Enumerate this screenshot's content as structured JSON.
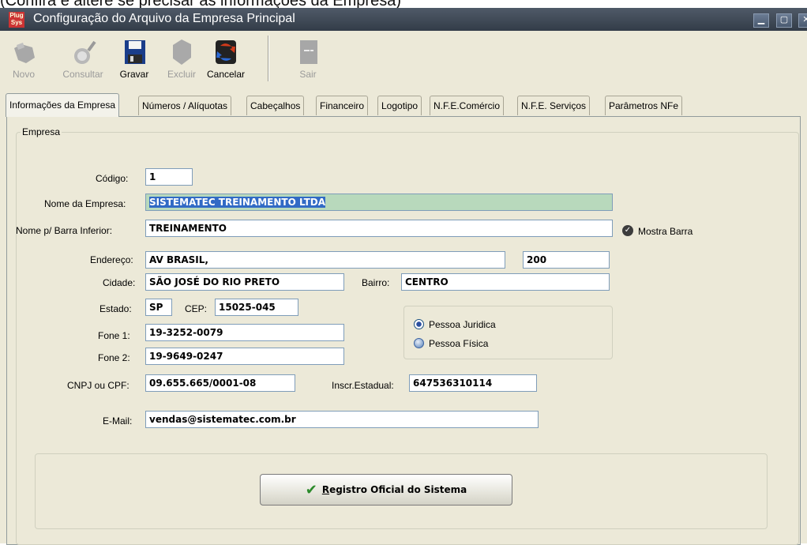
{
  "caption": "(Confira e altere se precisar as informações da Empresa)",
  "window": {
    "title": "Configuração do Arquivo da Empresa Principal",
    "app_icon_text": "Plug Sys"
  },
  "toolbar": {
    "novo": "Novo",
    "consultar": "Consultar",
    "gravar": "Gravar",
    "excluir": "Excluir",
    "cancelar": "Cancelar",
    "sair": "Sair"
  },
  "tabs": [
    "Informações da Empresa",
    "Números / Alíquotas",
    "Cabeçalhos",
    "Financeiro",
    "Logotipo",
    "N.F.E.Comércio",
    "N.F.E. Serviços",
    "Parâmetros NFe"
  ],
  "group_label": "Empresa",
  "labels": {
    "codigo": "Código:",
    "nome": "Nome da Empresa:",
    "barra": "Nome p/ Barra Inferior:",
    "mostra_barra": "Mostra Barra",
    "endereco": "Endereço:",
    "cidade": "Cidade:",
    "bairro": "Bairro:",
    "estado": "Estado:",
    "cep": "CEP:",
    "fone1": "Fone 1:",
    "fone2": "Fone 2:",
    "cnpj": "CNPJ ou CPF:",
    "inscr": "Inscr.Estadual:",
    "email": "E-Mail:"
  },
  "values": {
    "codigo": "1",
    "nome": "SISTEMATEC TREINAMENTO LTDA",
    "barra": "TREINAMENTO",
    "endereco": "AV BRASIL,",
    "numero": "200",
    "cidade": "SÃO JOSÉ DO RIO PRETO",
    "bairro": "CENTRO",
    "estado": "SP",
    "cep": "15025-045",
    "fone1": "19-3252-0079",
    "fone2": "19-9649-0247",
    "cnpj": "09.655.665/0001-08",
    "inscr": "647536310114",
    "email": "vendas@sistematec.com.br"
  },
  "radios": {
    "juridica": "Pessoa Juridica",
    "fisica": "Pessoa Física",
    "selected": "juridica"
  },
  "register_button": {
    "accel": "R",
    "rest": "egistro Oficial do Sistema"
  },
  "colors": {
    "title_bar": "#3f4856",
    "window_bg": "#ece9d8",
    "highlight_field": "#b8d9bc",
    "selection": "#316ac5"
  }
}
